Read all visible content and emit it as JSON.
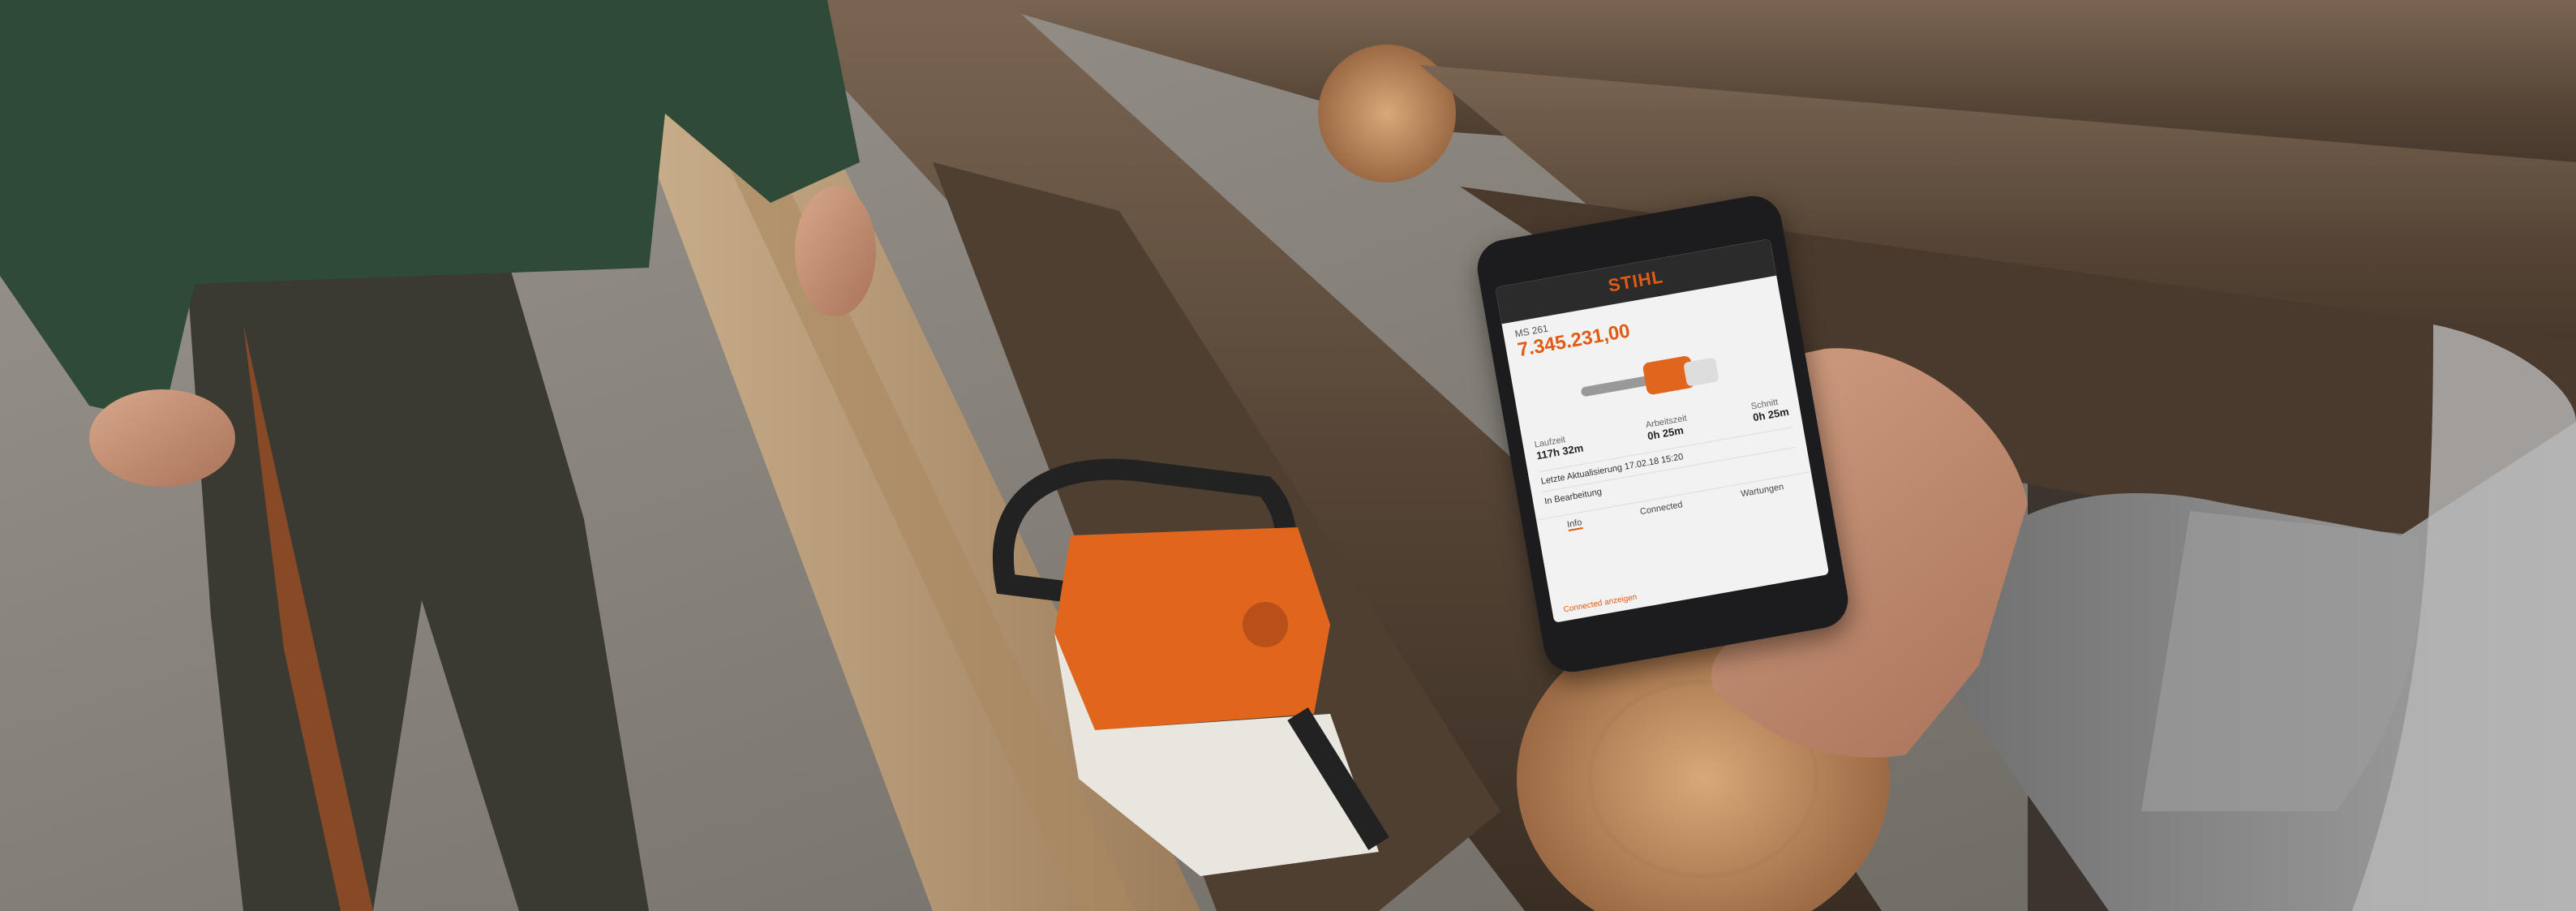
{
  "photo": {
    "subject": "chainsaw-on-log-pile",
    "colors": {
      "ground": "#8c8780",
      "jacket": "#2f4a36",
      "trousers": "#3b3a32",
      "plank": "#b79a78",
      "log_bark": "#5a4a3b",
      "log_end": "#c79766",
      "chainsaw_orange": "#e0661e",
      "chainsaw_white": "#e9e6e0",
      "sleeve": "#8f8f8f",
      "phone_body": "#1c1c1e",
      "screen_bg": "#f2f2f2",
      "accent": "#e35b13"
    }
  },
  "phone_screen": {
    "brand": "STIHL",
    "model_label": "MS 261",
    "value": "7.345.231,00",
    "stat_1_label": "Laufzeit",
    "stat_1_value": "117h 32m",
    "stat_2_label": "Arbeitszeit",
    "stat_2_value": "0h 25m",
    "stat_3_label": "Schnitt",
    "stat_3_value": "0h 25m",
    "row_1": "Letzte Aktualisierung 17.02.18 15:20",
    "row_2": "In Bearbeitung",
    "tab_1": "Info",
    "tab_2": "Connected",
    "tab_3": "Wartungen",
    "footer": "Connected anzeigen"
  }
}
